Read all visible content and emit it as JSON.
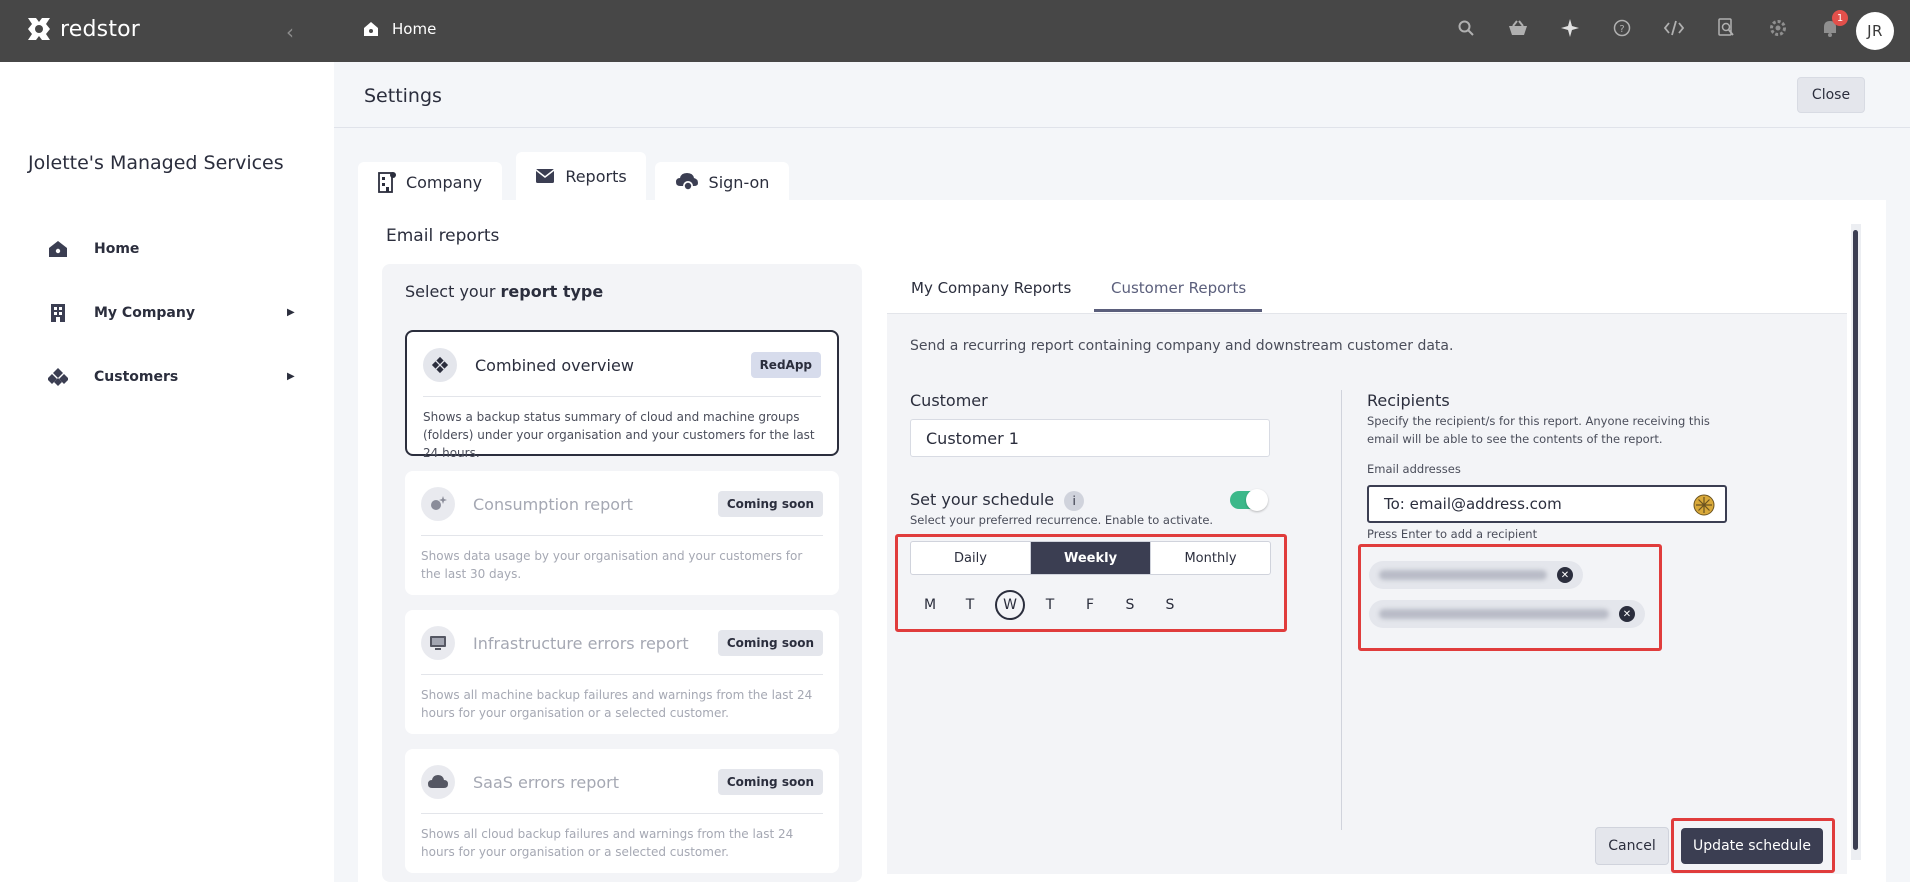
{
  "topbar": {
    "brand": "redstor",
    "breadcrumb": "Home",
    "notification_count": "1",
    "avatar_initials": "JR",
    "icons": [
      "search-icon",
      "basket-icon",
      "sparkle-icon",
      "help-icon",
      "code-icon",
      "search-doc-icon",
      "gear-icon",
      "bell-icon"
    ]
  },
  "sidebar": {
    "org_name": "Jolette's Managed Services",
    "items": [
      {
        "label": "Home",
        "icon": "home-icon"
      },
      {
        "label": "My Company",
        "icon": "building-icon"
      },
      {
        "label": "Customers",
        "icon": "customers-icon"
      }
    ]
  },
  "header": {
    "title": "Settings",
    "close_label": "Close"
  },
  "tabs": [
    {
      "label": "Company",
      "icon": "building-icon"
    },
    {
      "label": "Reports",
      "icon": "mail-icon"
    },
    {
      "label": "Sign-on",
      "icon": "cloud-lock-icon"
    }
  ],
  "email_reports": {
    "title": "Email reports",
    "select_prefix": "Select your ",
    "select_bold": "report type",
    "cards": [
      {
        "title": "Combined overview",
        "badge": "RedApp",
        "desc": "Shows a backup status summary of cloud and machine groups (folders) under your organisation and your customers for the last 24 hours."
      },
      {
        "title": "Consumption report",
        "badge": "Coming soon",
        "desc": "Shows data usage by your organisation and your customers for the last 30 days."
      },
      {
        "title": "Infrastructure errors report",
        "badge": "Coming soon",
        "desc": "Shows all machine backup failures and warnings from the last 24 hours for your organisation or a selected customer."
      },
      {
        "title": "SaaS errors report",
        "badge": "Coming soon",
        "desc": "Shows all cloud backup failures and warnings from the last 24 hours for your organisation or a selected customer."
      }
    ]
  },
  "report_tabs": [
    "My Company Reports",
    "Customer Reports"
  ],
  "customer_reports": {
    "intro": "Send a recurring report containing company and downstream customer data.",
    "customer_label": "Customer",
    "customer_value": "Customer 1",
    "schedule_label": "Set your schedule",
    "schedule_hint": "Select your preferred recurrence. Enable to activate.",
    "schedule_enabled": true,
    "recurrence_options": [
      "Daily",
      "Weekly",
      "Monthly"
    ],
    "recurrence_selected": "Weekly",
    "days": [
      "M",
      "T",
      "W",
      "T",
      "F",
      "S",
      "S"
    ],
    "selected_day": "W",
    "recipients_label": "Recipients",
    "recipients_desc": "Specify the recipient/s for this report. Anyone receiving this email will be able to see the contents of the report.",
    "email_label": "Email addresses",
    "email_placeholder": "To: email@address.com",
    "email_hint": "Press Enter to add a recipient",
    "cancel_label": "Cancel",
    "update_label": "Update schedule"
  },
  "colors": {
    "topbar": "#474747",
    "accent_dark": "#3b3e52",
    "toggle_on": "#3cb88a",
    "highlight": "#e03c3c",
    "badge_red": "#e2504b"
  }
}
